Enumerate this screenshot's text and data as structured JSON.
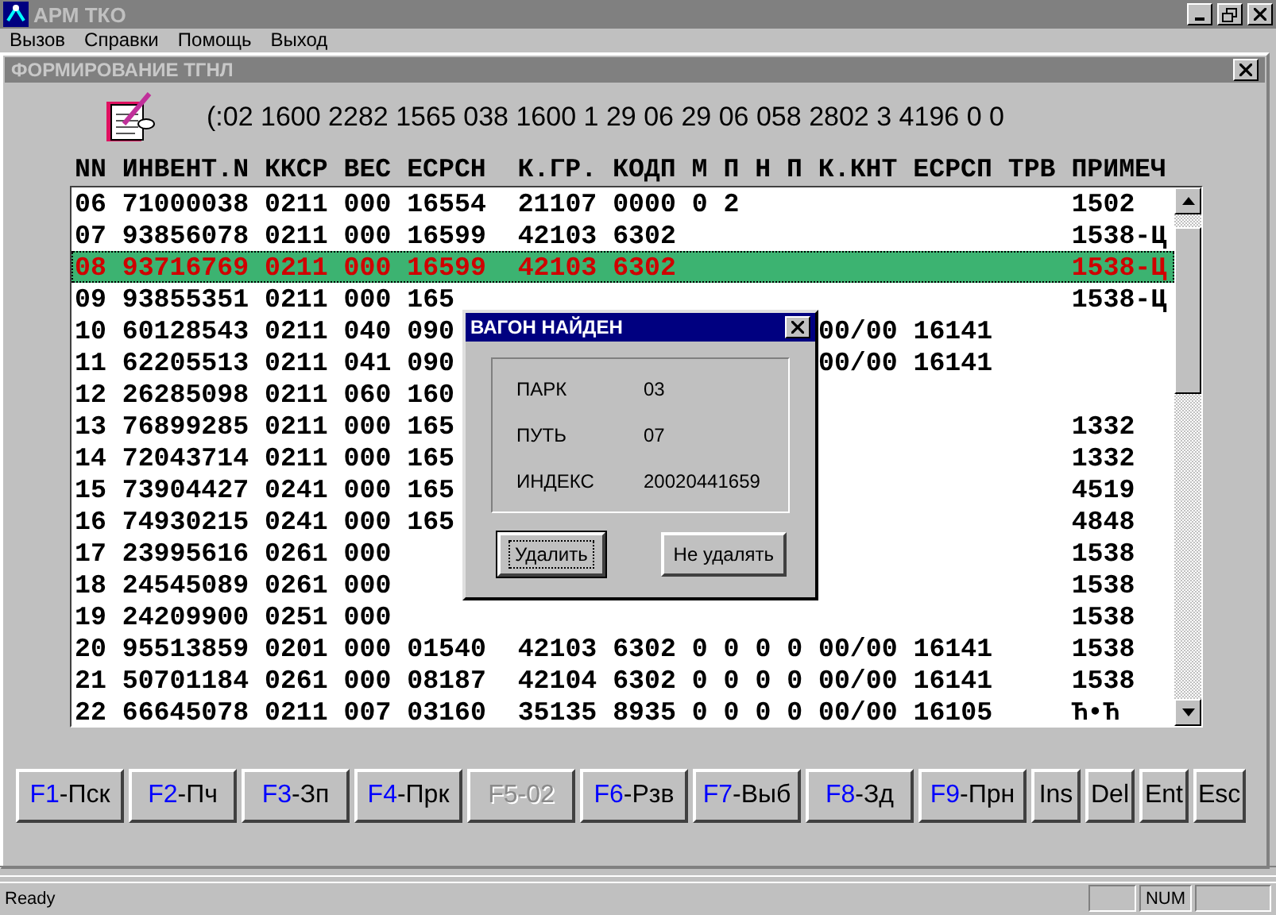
{
  "app_window": {
    "title": "АРМ ТКО"
  },
  "menu": [
    "Вызов",
    "Справки",
    "Помощь",
    "Выход"
  ],
  "window": {
    "title": "ФОРМИРОВАНИЕ ТГНЛ"
  },
  "code_line": "(:02 1600 2282 1565 038 1600 1 29 06 29 06 058 2802 3 4196 0 0",
  "table": {
    "columns": [
      "NN",
      "ИНВЕНТ.N",
      "ККСР",
      "ВЕС",
      "ЕСРСН",
      "К.ГР.",
      "КОДП",
      "М",
      "П",
      "Н",
      "П",
      "К.КНТ",
      "ЕСРСП",
      "ТРВ",
      "ПРИМЕЧ"
    ],
    "rows": [
      {
        "text": "06 71000038 0211 000 16554  21107 0000 0 2",
        "note": "1502",
        "selected": false
      },
      {
        "text": "07 93856078 0211 000 16599  42103 6302",
        "note": "1538-Ц",
        "selected": false
      },
      {
        "text": "08 93716769 0211 000 16599  42103 6302",
        "note": "1538-Ц",
        "selected": true
      },
      {
        "text": "09 93855351 0211 000 165",
        "note": "1538-Ц",
        "selected": false
      },
      {
        "text": "10 60128543 0211 040 090",
        "text_right": "00/00 16141",
        "selected": false
      },
      {
        "text": "11 62205513 0211 041 090",
        "text_right": "00/00 16141",
        "selected": false
      },
      {
        "text": "12 26285098 0211 060 160",
        "selected": false
      },
      {
        "text": "13 76899285 0211 000 165",
        "note": "1332",
        "selected": false
      },
      {
        "text": "14 72043714 0211 000 165",
        "note": "1332",
        "selected": false
      },
      {
        "text": "15 73904427 0241 000 165",
        "note": "4519",
        "selected": false
      },
      {
        "text": "16 74930215 0241 000 165",
        "note": "4848",
        "selected": false
      },
      {
        "text": "17 23995616 0261 000",
        "note": "1538",
        "selected": false
      },
      {
        "text": "18 24545089 0261 000",
        "note": "1538",
        "selected": false
      },
      {
        "text": "19 24209900 0251 000",
        "note": "1538",
        "selected": false
      },
      {
        "text": "20 95513859 0201 000 01540  42103 6302 0 0 0 0 00/00 16141",
        "note": "1538",
        "selected": false
      },
      {
        "text": "21 50701184 0261 000 08187  42104 6302 0 0 0 0 00/00 16141",
        "note": "1538",
        "selected": false
      },
      {
        "text": "22 66645078 0211 007 03160  35135 8935 0 0 0 0 00/00 16105",
        "note": "Ћ•Ћ",
        "selected": false
      }
    ]
  },
  "dialog": {
    "title": "ВАГОН НАЙДЕН",
    "fields": [
      {
        "label": "ПАРК",
        "value": "03"
      },
      {
        "label": "ПУТЬ",
        "value": "07"
      },
      {
        "label": "ИНДЕКС",
        "value": "20020441659"
      }
    ],
    "buttons": [
      {
        "label": "Удалить",
        "default": true
      },
      {
        "label": "Не удалять",
        "default": false
      }
    ]
  },
  "keys": [
    {
      "key": "F1",
      "label": "-Пск",
      "disabled": false
    },
    {
      "key": "F2",
      "label": "-Пч",
      "disabled": false
    },
    {
      "key": "F3",
      "label": "-Зп",
      "disabled": false
    },
    {
      "key": "F4",
      "label": "-Прк",
      "disabled": false
    },
    {
      "key": "F5",
      "label": "-02",
      "disabled": true
    },
    {
      "key": "F6",
      "label": "-Рзв",
      "disabled": false
    },
    {
      "key": "F7",
      "label": "-Выб",
      "disabled": false
    },
    {
      "key": "F8",
      "label": "-Зд",
      "disabled": false
    },
    {
      "key": "F9",
      "label": "-Прн",
      "disabled": false
    },
    {
      "key": "Ins",
      "disabled": false
    },
    {
      "key": "Del",
      "disabled": false
    },
    {
      "key": "Ent",
      "disabled": false
    },
    {
      "key": "Esc",
      "disabled": false
    }
  ],
  "status_bar": {
    "text": "Ready",
    "panes": [
      "NUM"
    ]
  }
}
